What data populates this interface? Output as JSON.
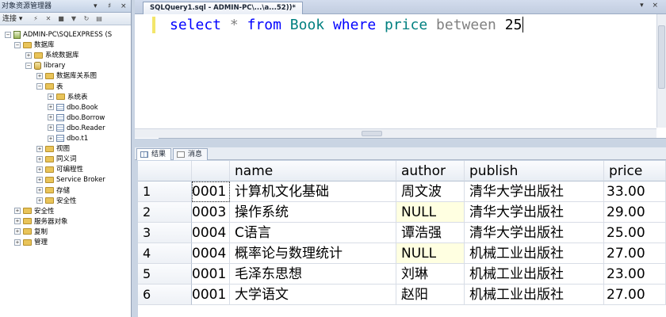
{
  "object_explorer": {
    "title": "对象资源管理器",
    "title_buttons": [
      "▾",
      "♯",
      "×"
    ],
    "toolbar": {
      "connect_label": "连接 ▾"
    },
    "tree": [
      {
        "label": "ADMIN-PC\\SQLEXPRESS (S",
        "level": 0,
        "expand": "−",
        "icon": "server"
      },
      {
        "label": "数据库",
        "level": 1,
        "expand": "−",
        "icon": "folder"
      },
      {
        "label": "系统数据库",
        "level": 2,
        "expand": "+",
        "icon": "folder"
      },
      {
        "label": "library",
        "level": 2,
        "expand": "−",
        "icon": "db"
      },
      {
        "label": "数据库关系图",
        "level": 3,
        "expand": "+",
        "icon": "folder"
      },
      {
        "label": "表",
        "level": 3,
        "expand": "−",
        "icon": "folder"
      },
      {
        "label": "系统表",
        "level": 4,
        "expand": "+",
        "icon": "folder"
      },
      {
        "label": "dbo.Book",
        "level": 4,
        "expand": "+",
        "icon": "table"
      },
      {
        "label": "dbo.Borrow",
        "level": 4,
        "expand": "+",
        "icon": "table"
      },
      {
        "label": "dbo.Reader",
        "level": 4,
        "expand": "+",
        "icon": "table"
      },
      {
        "label": "dbo.t1",
        "level": 4,
        "expand": "+",
        "icon": "table"
      },
      {
        "label": "视图",
        "level": 3,
        "expand": "+",
        "icon": "folder"
      },
      {
        "label": "同义词",
        "level": 3,
        "expand": "+",
        "icon": "folder"
      },
      {
        "label": "可编程性",
        "level": 3,
        "expand": "+",
        "icon": "folder"
      },
      {
        "label": "Service Broker",
        "level": 3,
        "expand": "+",
        "icon": "folder"
      },
      {
        "label": "存储",
        "level": 3,
        "expand": "+",
        "icon": "folder"
      },
      {
        "label": "安全性",
        "level": 3,
        "expand": "+",
        "icon": "folder"
      },
      {
        "label": "安全性",
        "level": 1,
        "expand": "+",
        "icon": "folder"
      },
      {
        "label": "服务器对象",
        "level": 1,
        "expand": "+",
        "icon": "folder"
      },
      {
        "label": "复制",
        "level": 1,
        "expand": "+",
        "icon": "folder"
      },
      {
        "label": "管理",
        "level": 1,
        "expand": "+",
        "icon": "folder"
      }
    ]
  },
  "document": {
    "tab_label": "SQLQuery1.sql - ADMIN-PC\\...\\a...52))*",
    "tab_buttons": "▾ ×"
  },
  "editor": {
    "tokens": [
      {
        "text": "select",
        "cls": "kw"
      },
      {
        "text": " ",
        "cls": ""
      },
      {
        "text": "*",
        "cls": "op"
      },
      {
        "text": " ",
        "cls": ""
      },
      {
        "text": "from",
        "cls": "kw"
      },
      {
        "text": " ",
        "cls": ""
      },
      {
        "text": "Book",
        "cls": "id"
      },
      {
        "text": " ",
        "cls": ""
      },
      {
        "text": "where",
        "cls": "kw"
      },
      {
        "text": " ",
        "cls": ""
      },
      {
        "text": "price",
        "cls": "id"
      },
      {
        "text": " ",
        "cls": ""
      },
      {
        "text": "between",
        "cls": "gray"
      },
      {
        "text": " ",
        "cls": ""
      },
      {
        "text": "25",
        "cls": "num"
      }
    ]
  },
  "results": {
    "tabs": [
      {
        "label": "结果",
        "active": true,
        "icon": "grid"
      },
      {
        "label": "消息",
        "active": false,
        "icon": "msg"
      }
    ],
    "columns": [
      "",
      "name",
      "author",
      "publish",
      "price"
    ],
    "rows": [
      {
        "n": "1",
        "id": "0001",
        "name": "计算机文化基础",
        "author": "周文波",
        "publish": "清华大学出版社",
        "price": "33.00",
        "author_null": false
      },
      {
        "n": "2",
        "id": "0003",
        "name": "操作系统",
        "author": "NULL",
        "publish": "清华大学出版社",
        "price": "29.00",
        "author_null": true
      },
      {
        "n": "3",
        "id": "0004",
        "name": "C语言",
        "author": "谭浩强",
        "publish": "清华大学出版社",
        "price": "25.00",
        "author_null": false
      },
      {
        "n": "4",
        "id": "0004",
        "name": "概率论与数理统计",
        "author": "NULL",
        "publish": "机械工业出版社",
        "price": "27.00",
        "author_null": true
      },
      {
        "n": "5",
        "id": "0001",
        "name": "毛泽东思想",
        "author": "刘琳",
        "publish": "机械工业出版社",
        "price": "23.00",
        "author_null": false
      },
      {
        "n": "6",
        "id": "0001",
        "name": "大学语文",
        "author": "赵阳",
        "publish": "机械工业出版社",
        "price": "27.00",
        "author_null": false
      }
    ]
  }
}
